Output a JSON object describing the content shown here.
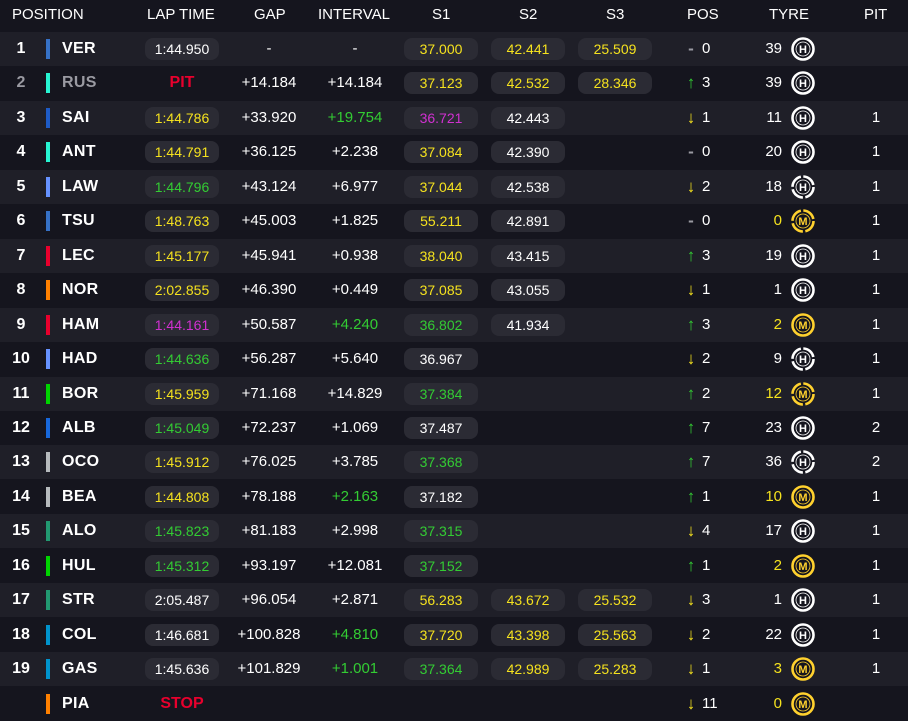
{
  "colors": {
    "background": "#15151e",
    "row_alt": "#1f1f28",
    "pill": "#2b2b34",
    "white": "#ffffff",
    "grey": "#9a9aa2",
    "yellow": "#f5e21e",
    "green": "#33cc33",
    "purple": "#d030d0",
    "red": "#e8002d",
    "tyre_medium": "#ffd12e",
    "tyre_hard": "#ffffff"
  },
  "headers": {
    "position": "POSITION",
    "lap_time": "LAP TIME",
    "gap": "GAP",
    "interval": "INTERVAL",
    "s1": "S1",
    "s2": "S2",
    "s3": "S3",
    "pos": "POS",
    "tyre": "TYRE",
    "pit": "PIT"
  },
  "rows": [
    {
      "pos": "1",
      "code": "VER",
      "team_color": "#3671c6",
      "lap": "1:44.950",
      "lap_color": "white",
      "gap": "-",
      "interval": "-",
      "interval_color": "white",
      "s1": "37.000",
      "s1_color": "yellow",
      "s2": "42.441",
      "s2_color": "yellow",
      "s3": "25.509",
      "s3_color": "yellow",
      "delta_dir": "same",
      "delta": "0",
      "tyre_laps": "39",
      "tyre": "H",
      "tyre_icon": "hard-tyre-icon",
      "tyre_used": false,
      "pit": ""
    },
    {
      "pos": "2",
      "code": "RUS",
      "team_color": "#27f4d2",
      "dim": true,
      "pit_label": "PIT",
      "gap": "+14.184",
      "interval": "+14.184",
      "interval_color": "white",
      "s1": "37.123",
      "s1_color": "yellow",
      "s2": "42.532",
      "s2_color": "yellow",
      "s3": "28.346",
      "s3_color": "yellow",
      "delta_dir": "up",
      "delta": "3",
      "tyre_laps": "39",
      "tyre": "H",
      "tyre_icon": "hard-tyre-icon",
      "tyre_used": false,
      "pit": ""
    },
    {
      "pos": "3",
      "code": "SAI",
      "team_color": "#1e5bc6",
      "lap": "1:44.786",
      "lap_color": "yellow",
      "gap": "+33.920",
      "interval": "+19.754",
      "interval_color": "green",
      "s1": "36.721",
      "s1_color": "purple",
      "s2": "42.443",
      "s2_color": "white",
      "s3": "",
      "delta_dir": "down",
      "delta": "1",
      "tyre_laps": "11",
      "tyre": "H",
      "tyre_icon": "hard-tyre-icon",
      "tyre_used": false,
      "pit": "1"
    },
    {
      "pos": "4",
      "code": "ANT",
      "team_color": "#27f4d2",
      "lap": "1:44.791",
      "lap_color": "yellow",
      "gap": "+36.125",
      "interval": "+2.238",
      "interval_color": "white",
      "s1": "37.084",
      "s1_color": "yellow",
      "s2": "42.390",
      "s2_color": "white",
      "s3": "",
      "delta_dir": "same",
      "delta": "0",
      "tyre_laps": "20",
      "tyre": "H",
      "tyre_icon": "hard-tyre-icon",
      "tyre_used": false,
      "pit": "1"
    },
    {
      "pos": "5",
      "code": "LAW",
      "team_color": "#6692ff",
      "lap": "1:44.796",
      "lap_color": "green",
      "gap": "+43.124",
      "interval": "+6.977",
      "interval_color": "white",
      "s1": "37.044",
      "s1_color": "yellow",
      "s2": "42.538",
      "s2_color": "white",
      "s3": "",
      "delta_dir": "down",
      "delta": "2",
      "tyre_laps": "18",
      "tyre": "H",
      "tyre_icon": "hard-tyre-icon",
      "tyre_used": true,
      "pit": "1"
    },
    {
      "pos": "6",
      "code": "TSU",
      "team_color": "#3671c6",
      "lap": "1:48.763",
      "lap_color": "yellow",
      "gap": "+45.003",
      "interval": "+1.825",
      "interval_color": "white",
      "s1": "55.211",
      "s1_color": "yellow",
      "s2": "42.891",
      "s2_color": "white",
      "s3": "",
      "delta_dir": "same",
      "delta": "0",
      "tyre_laps": "0",
      "tyre_laps_color": "yellow",
      "tyre": "M",
      "tyre_icon": "medium-tyre-icon",
      "tyre_used": true,
      "pit": "1"
    },
    {
      "pos": "7",
      "code": "LEC",
      "team_color": "#e8002d",
      "lap": "1:45.177",
      "lap_color": "yellow",
      "gap": "+45.941",
      "interval": "+0.938",
      "interval_color": "white",
      "s1": "38.040",
      "s1_color": "yellow",
      "s2": "43.415",
      "s2_color": "white",
      "s3": "",
      "delta_dir": "up",
      "delta": "3",
      "tyre_laps": "19",
      "tyre": "H",
      "tyre_icon": "hard-tyre-icon",
      "tyre_used": false,
      "pit": "1"
    },
    {
      "pos": "8",
      "code": "NOR",
      "team_color": "#ff8000",
      "lap": "2:02.855",
      "lap_color": "yellow",
      "gap": "+46.390",
      "interval": "+0.449",
      "interval_color": "white",
      "s1": "37.085",
      "s1_color": "yellow",
      "s2": "43.055",
      "s2_color": "white",
      "s3": "",
      "delta_dir": "down",
      "delta": "1",
      "tyre_laps": "1",
      "tyre": "H",
      "tyre_icon": "hard-tyre-icon",
      "tyre_used": false,
      "pit": "1"
    },
    {
      "pos": "9",
      "code": "HAM",
      "team_color": "#e8002d",
      "lap": "1:44.161",
      "lap_color": "purple",
      "gap": "+50.587",
      "interval": "+4.240",
      "interval_color": "green",
      "s1": "36.802",
      "s1_color": "green",
      "s2": "41.934",
      "s2_color": "white",
      "s3": "",
      "delta_dir": "up",
      "delta": "3",
      "tyre_laps": "2",
      "tyre_laps_color": "yellow",
      "tyre": "M",
      "tyre_icon": "medium-tyre-icon",
      "tyre_used": false,
      "pit": "1"
    },
    {
      "pos": "10",
      "code": "HAD",
      "team_color": "#6692ff",
      "lap": "1:44.636",
      "lap_color": "green",
      "gap": "+56.287",
      "interval": "+5.640",
      "interval_color": "white",
      "s1": "36.967",
      "s1_color": "white",
      "s2": "",
      "s3": "",
      "delta_dir": "down",
      "delta": "2",
      "tyre_laps": "9",
      "tyre": "H",
      "tyre_icon": "hard-tyre-icon",
      "tyre_used": true,
      "pit": "1"
    },
    {
      "pos": "11",
      "code": "BOR",
      "team_color": "#00d400",
      "lap": "1:45.959",
      "lap_color": "yellow",
      "gap": "+71.168",
      "interval": "+14.829",
      "interval_color": "white",
      "s1": "37.384",
      "s1_color": "green",
      "s2": "",
      "s3": "",
      "delta_dir": "up",
      "delta": "2",
      "tyre_laps": "12",
      "tyre_laps_color": "yellow",
      "tyre": "M",
      "tyre_icon": "medium-tyre-icon",
      "tyre_used": true,
      "pit": "1"
    },
    {
      "pos": "12",
      "code": "ALB",
      "team_color": "#1868db",
      "lap": "1:45.049",
      "lap_color": "green",
      "gap": "+72.237",
      "interval": "+1.069",
      "interval_color": "white",
      "s1": "37.487",
      "s1_color": "white",
      "s2": "",
      "s3": "",
      "delta_dir": "up",
      "delta": "7",
      "tyre_laps": "23",
      "tyre": "H",
      "tyre_icon": "hard-tyre-icon",
      "tyre_used": false,
      "pit": "2"
    },
    {
      "pos": "13",
      "code": "OCO",
      "team_color": "#b6babd",
      "lap": "1:45.912",
      "lap_color": "yellow",
      "gap": "+76.025",
      "interval": "+3.785",
      "interval_color": "white",
      "s1": "37.368",
      "s1_color": "green",
      "s2": "",
      "s3": "",
      "delta_dir": "up",
      "delta": "7",
      "tyre_laps": "36",
      "tyre": "H",
      "tyre_icon": "hard-tyre-icon",
      "tyre_used": true,
      "pit": "2"
    },
    {
      "pos": "14",
      "code": "BEA",
      "team_color": "#b6babd",
      "lap": "1:44.808",
      "lap_color": "yellow",
      "gap": "+78.188",
      "interval": "+2.163",
      "interval_color": "green",
      "s1": "37.182",
      "s1_color": "white",
      "s2": "",
      "s3": "",
      "delta_dir": "up",
      "delta": "1",
      "tyre_laps": "10",
      "tyre_laps_color": "yellow",
      "tyre": "M",
      "tyre_icon": "medium-tyre-icon",
      "tyre_used": false,
      "pit": "1"
    },
    {
      "pos": "15",
      "code": "ALO",
      "team_color": "#229971",
      "lap": "1:45.823",
      "lap_color": "green",
      "gap": "+81.183",
      "interval": "+2.998",
      "interval_color": "white",
      "s1": "37.315",
      "s1_color": "green",
      "s2": "",
      "s3": "",
      "delta_dir": "down",
      "delta": "4",
      "tyre_laps": "17",
      "tyre": "H",
      "tyre_icon": "hard-tyre-icon",
      "tyre_used": false,
      "pit": "1"
    },
    {
      "pos": "16",
      "code": "HUL",
      "team_color": "#00d400",
      "lap": "1:45.312",
      "lap_color": "green",
      "gap": "+93.197",
      "interval": "+12.081",
      "interval_color": "white",
      "s1": "37.152",
      "s1_color": "green",
      "s2": "",
      "s3": "",
      "delta_dir": "up",
      "delta": "1",
      "tyre_laps": "2",
      "tyre_laps_color": "yellow",
      "tyre": "M",
      "tyre_icon": "medium-tyre-icon",
      "tyre_used": false,
      "pit": "1"
    },
    {
      "pos": "17",
      "code": "STR",
      "team_color": "#229971",
      "lap": "2:05.487",
      "lap_color": "white",
      "gap": "+96.054",
      "interval": "+2.871",
      "interval_color": "white",
      "s1": "56.283",
      "s1_color": "yellow",
      "s2": "43.672",
      "s2_color": "yellow",
      "s3": "25.532",
      "s3_color": "yellow",
      "delta_dir": "down",
      "delta": "3",
      "tyre_laps": "1",
      "tyre": "H",
      "tyre_icon": "hard-tyre-icon",
      "tyre_used": false,
      "pit": "1"
    },
    {
      "pos": "18",
      "code": "COL",
      "team_color": "#0093cc",
      "lap": "1:46.681",
      "lap_color": "white",
      "gap": "+100.828",
      "interval": "+4.810",
      "interval_color": "green",
      "s1": "37.720",
      "s1_color": "yellow",
      "s2": "43.398",
      "s2_color": "yellow",
      "s3": "25.563",
      "s3_color": "yellow",
      "delta_dir": "down",
      "delta": "2",
      "tyre_laps": "22",
      "tyre": "H",
      "tyre_icon": "hard-tyre-icon",
      "tyre_used": false,
      "pit": "1"
    },
    {
      "pos": "19",
      "code": "GAS",
      "team_color": "#0093cc",
      "lap": "1:45.636",
      "lap_color": "white",
      "gap": "+101.829",
      "interval": "+1.001",
      "interval_color": "green",
      "s1": "37.364",
      "s1_color": "green",
      "s2": "42.989",
      "s2_color": "yellow",
      "s3": "25.283",
      "s3_color": "yellow",
      "delta_dir": "down",
      "delta": "1",
      "tyre_laps": "3",
      "tyre_laps_color": "yellow",
      "tyre": "M",
      "tyre_icon": "medium-tyre-icon",
      "tyre_used": false,
      "pit": "1"
    },
    {
      "pos": "",
      "code": "PIA",
      "team_color": "#ff8000",
      "pit_label": "STOP",
      "gap": "",
      "interval": "",
      "s1": "",
      "s2": "",
      "s3": "",
      "delta_dir": "down",
      "delta": "11",
      "tyre_laps": "0",
      "tyre_laps_color": "yellow",
      "tyre": "M",
      "tyre_icon": "medium-tyre-icon",
      "tyre_used": false,
      "pit": ""
    }
  ]
}
